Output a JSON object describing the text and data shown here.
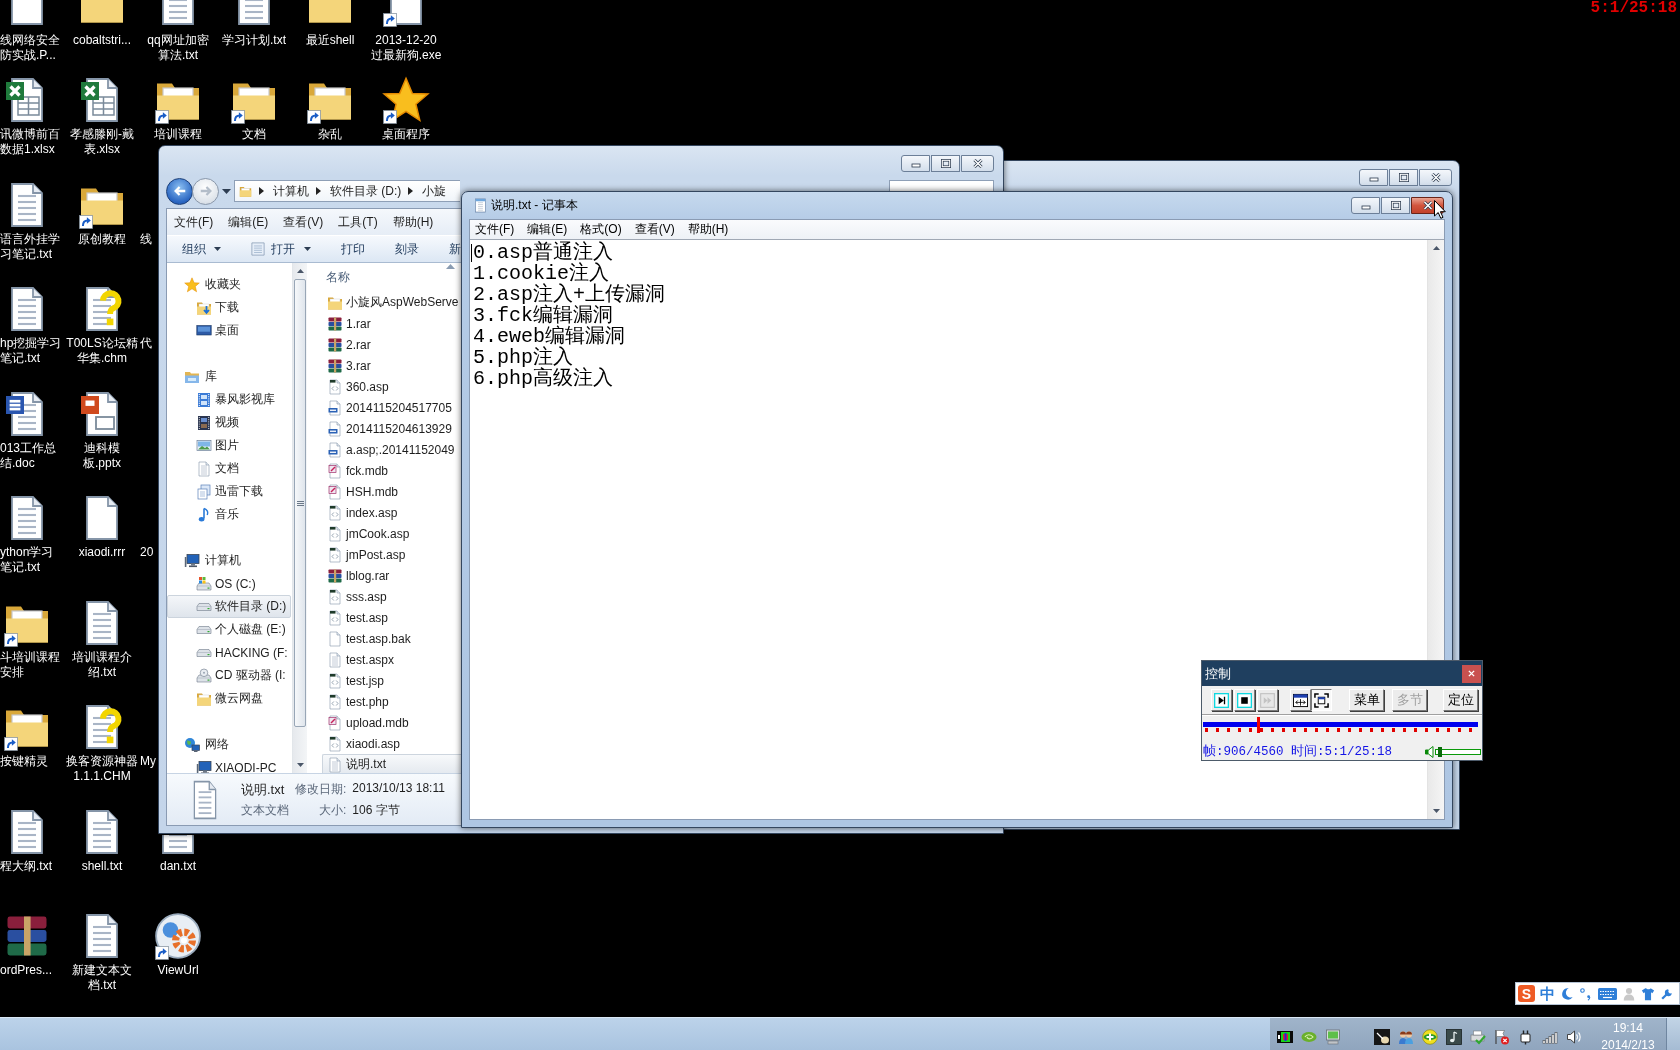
{
  "recording_timer": "5:1/25:18",
  "desktop": {
    "rows": [
      {
        "icons": [
          {
            "label": "线网络安全防实战.P...",
            "kind": "blank",
            "shortcut": false
          },
          {
            "label": "cobaltstri...",
            "kind": "folder",
            "shortcut": false
          },
          {
            "label": "qq网址加密算法.txt",
            "kind": "text",
            "shortcut": false
          },
          {
            "label": "学习计划.txt",
            "kind": "text",
            "shortcut": false
          },
          {
            "label": "最近shell",
            "kind": "folder",
            "shortcut": false
          },
          {
            "label": "2013-12-20过最新狗.exe",
            "kind": "blank",
            "shortcut": true
          }
        ]
      },
      {
        "icons": [
          {
            "label": "讯微博前百数据1.xlsx",
            "kind": "excel",
            "shortcut": false
          },
          {
            "label": "孝感滕刚-戴表.xlsx",
            "kind": "excel",
            "shortcut": false
          },
          {
            "label": "培训课程",
            "kind": "folder",
            "shortcut": true
          },
          {
            "label": "文档",
            "kind": "folder",
            "shortcut": true
          },
          {
            "label": "杂乱",
            "kind": "folder",
            "shortcut": true
          },
          {
            "label": "桌面程序",
            "kind": "star",
            "shortcut": true
          }
        ]
      },
      {
        "icons": [
          {
            "label": "语言外挂学习笔记.txt",
            "kind": "text",
            "shortcut": false
          },
          {
            "label": "原创教程",
            "kind": "folder",
            "shortcut": true
          },
          {
            "label": "线",
            "kind": "covered"
          }
        ]
      },
      {
        "icons": [
          {
            "label": "hp挖掘学习笔记.txt",
            "kind": "text",
            "shortcut": false
          },
          {
            "label": "T00LS论坛精华集.chm",
            "kind": "chm",
            "shortcut": false
          },
          {
            "label": "代",
            "kind": "covered"
          }
        ]
      },
      {
        "icons": [
          {
            "label": "013工作总结.doc",
            "kind": "word",
            "shortcut": false
          },
          {
            "label": "迪科模板.pptx",
            "kind": "ppt",
            "shortcut": false
          }
        ]
      },
      {
        "icons": [
          {
            "label": "ython学习笔记.txt",
            "kind": "text",
            "shortcut": false
          },
          {
            "label": "xiaodi.rrr",
            "kind": "blank",
            "shortcut": false
          },
          {
            "label": "20",
            "kind": "covered"
          }
        ]
      },
      {
        "icons": [
          {
            "label": "斗培训课程安排",
            "kind": "folder",
            "shortcut": true
          },
          {
            "label": "培训课程介绍.txt",
            "kind": "text",
            "shortcut": false
          }
        ]
      },
      {
        "icons": [
          {
            "label": "按键精灵",
            "kind": "folder",
            "shortcut": true
          },
          {
            "label": "换客资源神器1.1.1.CHM",
            "kind": "chm",
            "shortcut": false
          },
          {
            "label": "My",
            "kind": "covered"
          }
        ]
      },
      {
        "icons": [
          {
            "label": "程大纲.txt",
            "kind": "text",
            "shortcut": false
          },
          {
            "label": "shell.txt",
            "kind": "text",
            "shortcut": false
          },
          {
            "label": "dan.txt",
            "kind": "text",
            "shortcut": false
          }
        ]
      },
      {
        "icons": [
          {
            "label": "ordPres...",
            "kind": "rar",
            "shortcut": false
          },
          {
            "label": "新建文本文档.txt",
            "kind": "text",
            "shortcut": false
          },
          {
            "label": "ViewUrl",
            "kind": "gear",
            "shortcut": true
          }
        ]
      }
    ]
  },
  "background_window": {
    "active": false
  },
  "explorer": {
    "active": false,
    "nav_buttons": [
      {
        "kind": "back",
        "disabled": false
      },
      {
        "kind": "forward",
        "disabled": true
      }
    ],
    "breadcrumbs": [
      "计算机",
      "软件目录 (D:)",
      "小旋"
    ],
    "menu": [
      "文件(F)",
      "编辑(E)",
      "查看(V)",
      "工具(T)",
      "帮助(H)"
    ],
    "toolbar": [
      {
        "label": "组织",
        "kind": "menu"
      },
      {
        "label": "打开",
        "kind": "app"
      },
      {
        "label": "打印",
        "kind": "plain"
      },
      {
        "label": "刻录",
        "kind": "plain"
      },
      {
        "label": "新",
        "kind": "plain"
      }
    ],
    "nav": [
      {
        "label": "收藏夹",
        "kind": "star",
        "selected": false,
        "children": [
          {
            "label": "下载",
            "kind": "download",
            "selected": false
          },
          {
            "label": "桌面",
            "kind": "desktop",
            "selected": false
          }
        ]
      },
      {
        "label": "库",
        "kind": "library",
        "selected": false,
        "children": [
          {
            "label": "暴风影视库",
            "kind": "filmlib",
            "selected": false
          },
          {
            "label": "视频",
            "kind": "film",
            "selected": false
          },
          {
            "label": "图片",
            "kind": "picture",
            "selected": false
          },
          {
            "label": "文档",
            "kind": "document",
            "selected": false
          },
          {
            "label": "迅雷下载",
            "kind": "dlstack",
            "selected": false
          },
          {
            "label": "音乐",
            "kind": "music",
            "selected": false
          }
        ]
      },
      {
        "label": "计算机",
        "kind": "computer",
        "selected": false,
        "children": [
          {
            "label": "OS (C:)",
            "kind": "driveos",
            "selected": false
          },
          {
            "label": "软件目录 (D:)",
            "kind": "drive",
            "selected": true
          },
          {
            "label": "个人磁盘 (E:)",
            "kind": "drive",
            "selected": false
          },
          {
            "label": "HACKING (F:",
            "kind": "drive",
            "selected": false
          },
          {
            "label": "CD 驱动器 (I:",
            "kind": "cd",
            "selected": false
          },
          {
            "label": "微云网盘",
            "kind": "folder",
            "selected": false
          }
        ]
      },
      {
        "label": "网络",
        "kind": "network",
        "selected": false,
        "children": [
          {
            "label": "XIAODI-PC",
            "kind": "computer",
            "selected": false
          }
        ]
      }
    ],
    "column_header": "名称",
    "files": [
      {
        "name": "小旋风AspWebServe",
        "kind": "folder",
        "selected": false
      },
      {
        "name": "1.rar",
        "kind": "rar",
        "selected": false
      },
      {
        "name": "2.rar",
        "kind": "rar",
        "selected": false
      },
      {
        "name": "3.rar",
        "kind": "rar",
        "selected": false
      },
      {
        "name": "360.asp",
        "kind": "script",
        "selected": false
      },
      {
        "name": "2014115204517705",
        "kind": "image",
        "selected": false
      },
      {
        "name": "2014115204613929",
        "kind": "image",
        "selected": false
      },
      {
        "name": "a.asp;.20141152049",
        "kind": "image",
        "selected": false
      },
      {
        "name": "fck.mdb",
        "kind": "mdb",
        "selected": false
      },
      {
        "name": "HSH.mdb",
        "kind": "mdb",
        "selected": false
      },
      {
        "name": "index.asp",
        "kind": "script",
        "selected": false
      },
      {
        "name": "jmCook.asp",
        "kind": "script",
        "selected": false
      },
      {
        "name": "jmPost.asp",
        "kind": "script",
        "selected": false
      },
      {
        "name": "lblog.rar",
        "kind": "rar",
        "selected": false
      },
      {
        "name": "sss.asp",
        "kind": "script",
        "selected": false
      },
      {
        "name": "test.asp",
        "kind": "script",
        "selected": false
      },
      {
        "name": "test.asp.bak",
        "kind": "blank",
        "selected": false
      },
      {
        "name": "test.aspx",
        "kind": "text",
        "selected": false
      },
      {
        "name": "test.jsp",
        "kind": "script",
        "selected": false
      },
      {
        "name": "test.php",
        "kind": "script",
        "selected": false
      },
      {
        "name": "upload.mdb",
        "kind": "mdb",
        "selected": false
      },
      {
        "name": "xiaodi.asp",
        "kind": "script",
        "selected": false
      },
      {
        "name": "说明.txt",
        "kind": "text",
        "selected": true
      }
    ],
    "details": {
      "name": "说明.txt",
      "type": "文本文档",
      "fields": [
        {
          "label": "修改日期:",
          "value": "2013/10/13 18:11"
        },
        {
          "label": "大小:",
          "value": "106 字节"
        }
      ]
    }
  },
  "notepad": {
    "active": true,
    "title": "说明.txt - 记事本",
    "menu": [
      "文件(F)",
      "编辑(E)",
      "格式(O)",
      "查看(V)",
      "帮助(H)"
    ],
    "lines": [
      "0.asp普通注入",
      "1.cookie注入",
      "2.asp注入+上传漏洞",
      "3.fck编辑漏洞",
      "4.eweb编辑漏洞",
      "5.php注入",
      "6.php高级注入"
    ]
  },
  "recorder": {
    "title": "控制",
    "buttons": [
      {
        "kind": "play",
        "disabled": false,
        "pressed": false
      },
      {
        "kind": "stop",
        "disabled": false,
        "pressed": false
      },
      {
        "kind": "step",
        "disabled": true,
        "pressed": false
      },
      {
        "kind": "fit",
        "disabled": false,
        "pressed": false
      },
      {
        "kind": "full",
        "disabled": false,
        "pressed": true
      },
      {
        "kind": "text",
        "label": "菜单",
        "disabled": false,
        "pressed": false
      },
      {
        "kind": "text",
        "label": "多节",
        "disabled": true,
        "pressed": false
      },
      {
        "kind": "text",
        "label": "定位",
        "disabled": false,
        "pressed": false
      }
    ],
    "level": 0.2,
    "status": "帧:906/4560 时间:5:1/25:18",
    "volume": {
      "level": 0.05
    }
  },
  "ime_bar": {
    "logo": "S",
    "mode": "中"
  },
  "clock": {
    "time": "19:14",
    "date": "2014/2/13"
  }
}
